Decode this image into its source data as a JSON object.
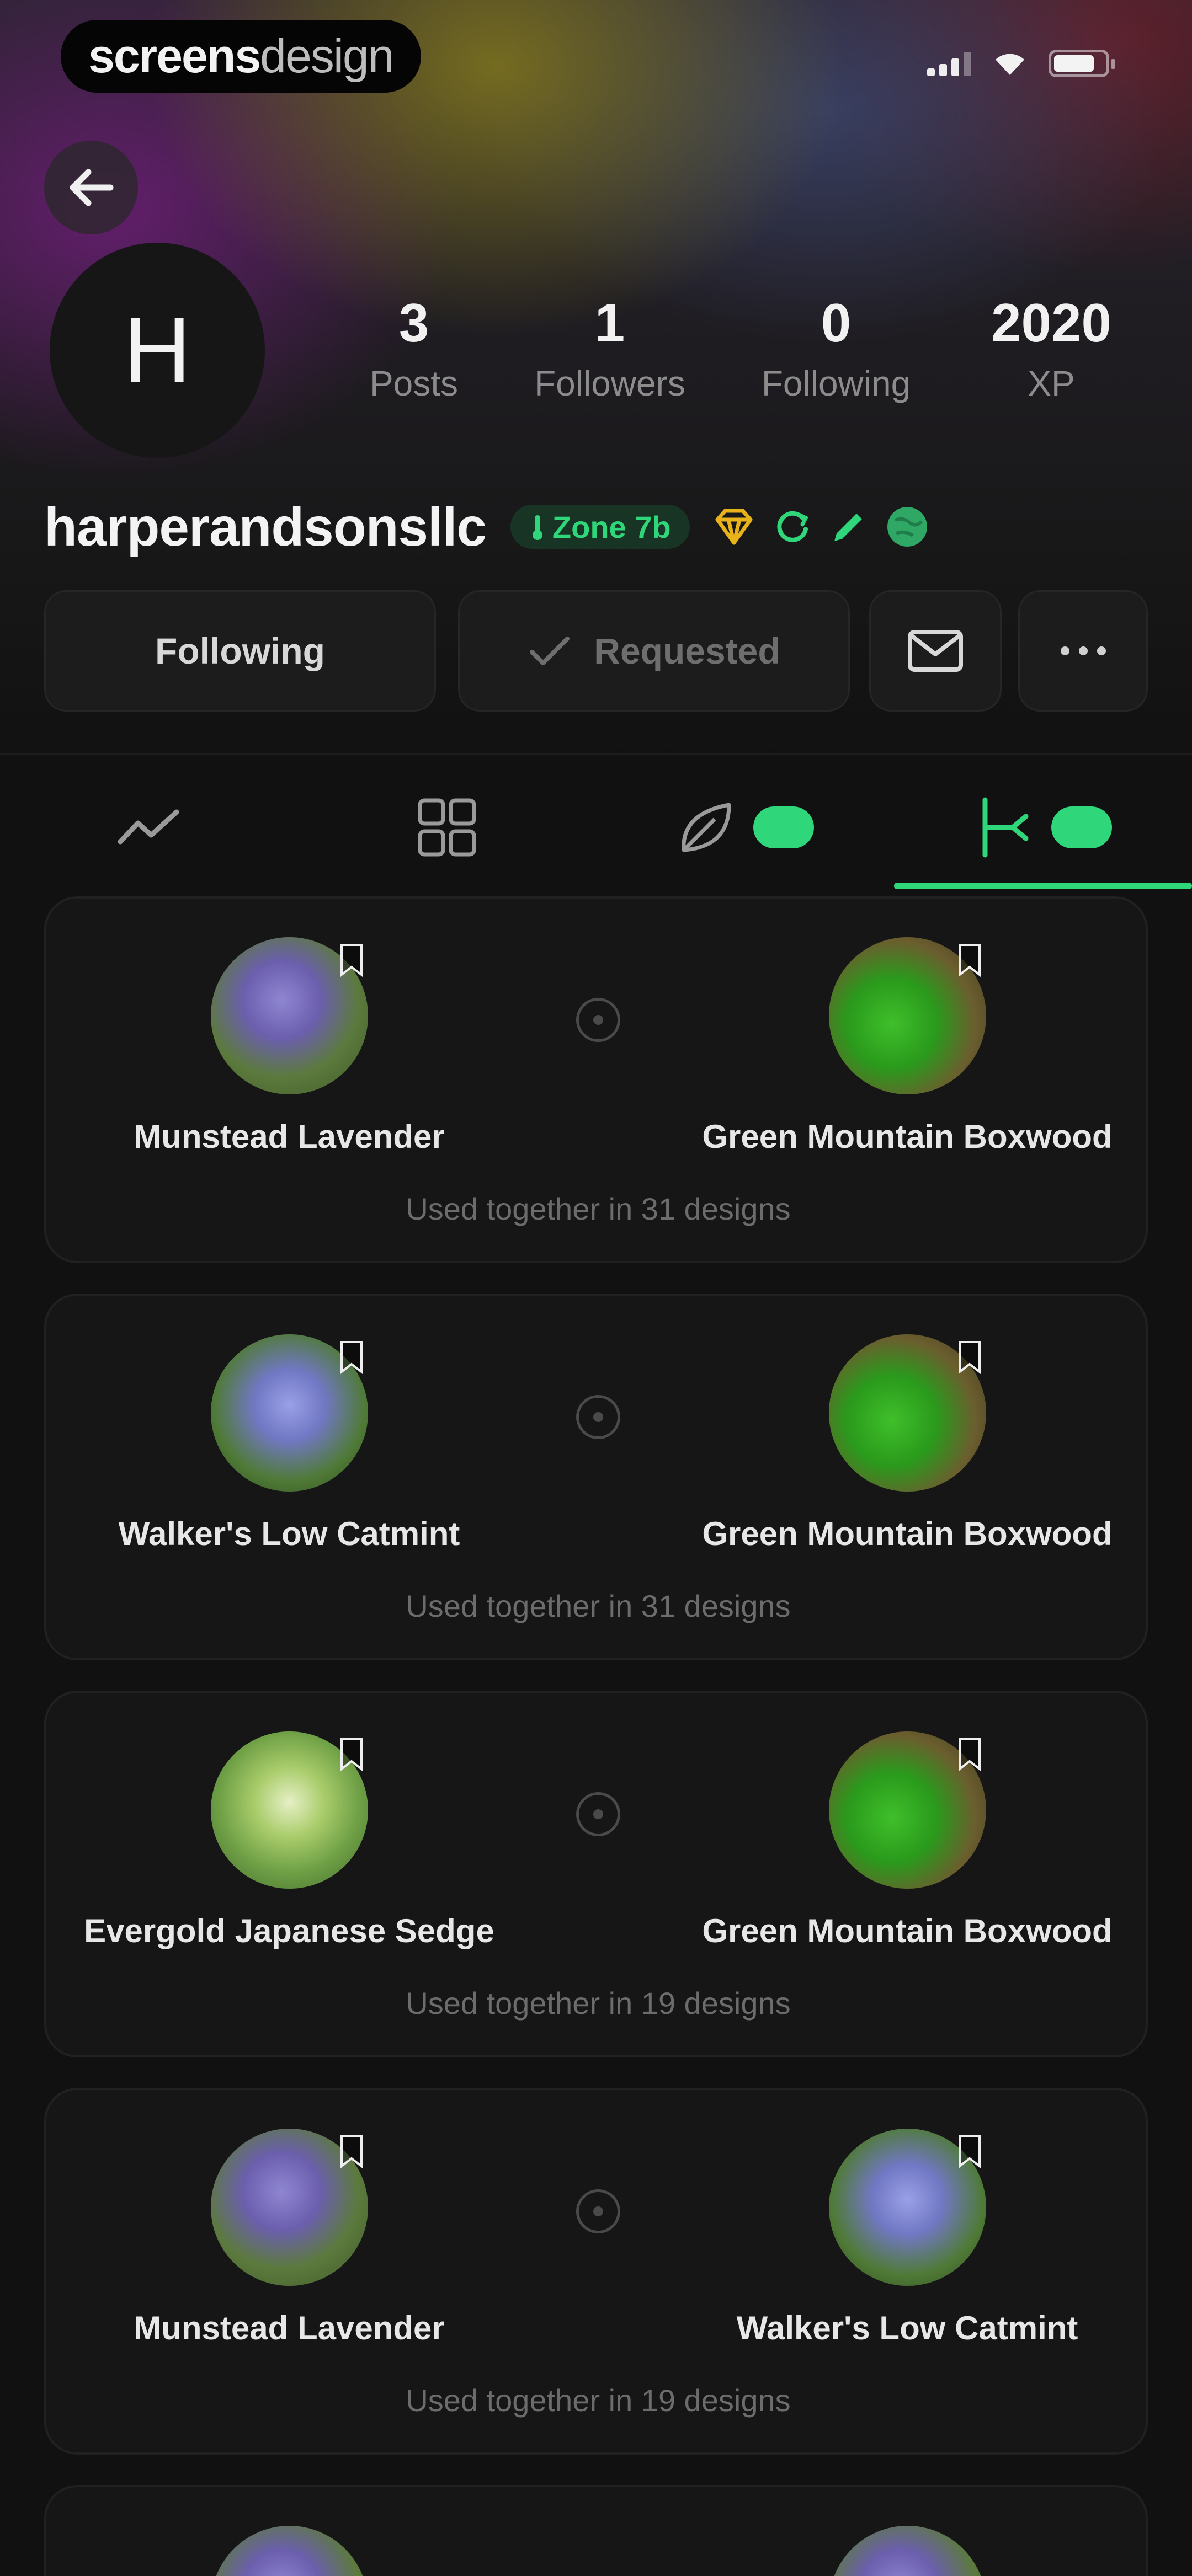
{
  "watermark": {
    "bold": "screens",
    "light": "design"
  },
  "profile": {
    "avatar_initial": "H",
    "username": "harperandsonsllc",
    "zone_badge": "Zone 7b",
    "stats": [
      {
        "value": "3",
        "label": "Posts"
      },
      {
        "value": "1",
        "label": "Followers"
      },
      {
        "value": "0",
        "label": "Following"
      },
      {
        "value": "2020",
        "label": "XP"
      }
    ]
  },
  "actions": {
    "following": "Following",
    "requested": "Requested"
  },
  "tabs": [
    {
      "icon": "activity-chart-icon"
    },
    {
      "icon": "grid-icon"
    },
    {
      "icon": "leaf-icon",
      "badge": ""
    },
    {
      "icon": "branch-combo-icon",
      "badge": "",
      "active": true
    }
  ],
  "pairings": [
    {
      "left": "Munstead Lavender",
      "right": "Green Mountain Boxwood",
      "usage": "Used together in 31 designs"
    },
    {
      "left": "Walker's Low Catmint",
      "right": "Green Mountain Boxwood",
      "usage": "Used together in 31 designs"
    },
    {
      "left": "Evergold Japanese Sedge",
      "right": "Green Mountain Boxwood",
      "usage": "Used together in 19 designs"
    },
    {
      "left": "Munstead Lavender",
      "right": "Walker's Low Catmint",
      "usage": "Used together in 19 designs"
    }
  ],
  "colors": {
    "accent": "#2fd67a",
    "background": "#111111",
    "card": "#161616"
  }
}
